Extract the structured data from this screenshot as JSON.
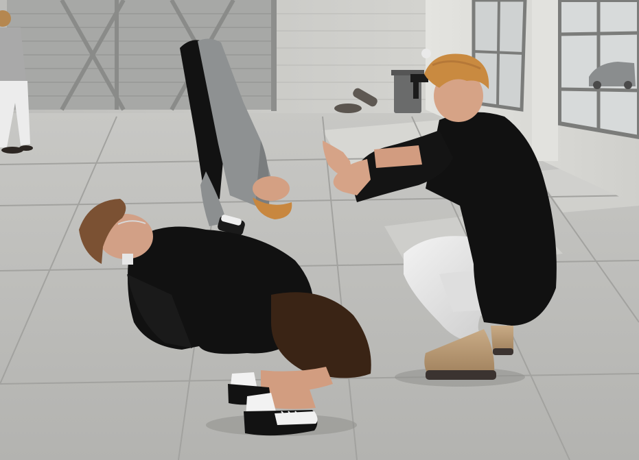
{
  "scene": {
    "type": "3d-virtual-world-view",
    "setting": "warehouse-interior",
    "colors": {
      "floor": "#b8b8b6",
      "floor_light": "#d8d8d4",
      "floor_lines": "#a3a3a0",
      "back_wall": "#c9c9c6",
      "garage_door": "#a9aaa8",
      "right_wall": "#d9d9d5",
      "window_frame": "#7d7e7c",
      "black_clothes": "#111111",
      "grey_sweater": "#8f9293",
      "white_pants": "#e6e6e6",
      "brown_shorts": "#3b2416",
      "tan_boots": "#b99a74",
      "skin": "#d5a184",
      "blond_hair": "#c98b46",
      "brown_hair": "#7c5235"
    }
  }
}
